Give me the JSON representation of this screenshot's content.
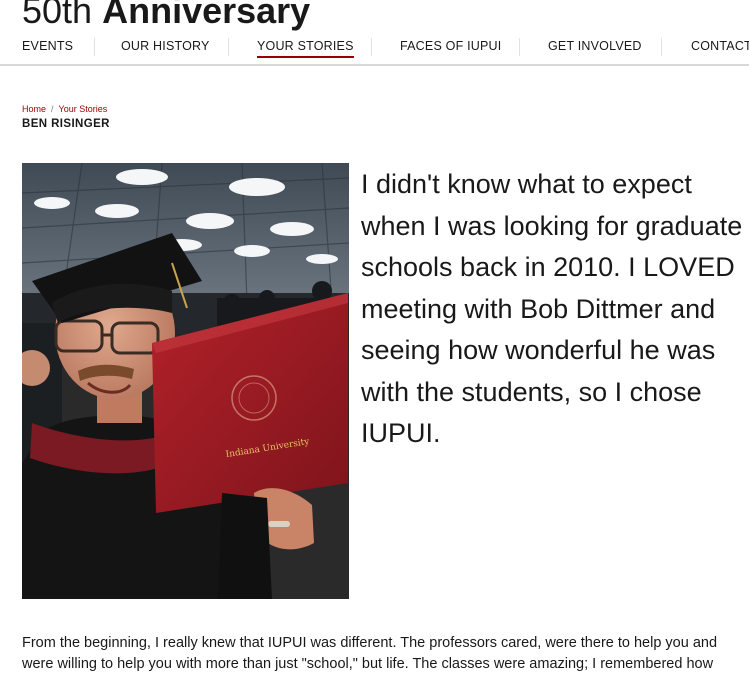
{
  "header": {
    "title_light": "50th",
    "title_bold": "Anniversary"
  },
  "nav": {
    "items": [
      {
        "label": "EVENTS"
      },
      {
        "label": "OUR HISTORY"
      },
      {
        "label": "YOUR STORIES",
        "active": true
      },
      {
        "label": "FACES OF IUPUI"
      },
      {
        "label": "GET INVOLVED"
      },
      {
        "label": "CONTACT"
      }
    ]
  },
  "breadcrumb": {
    "home": "Home",
    "separator": "/",
    "current": "Your Stories"
  },
  "page": {
    "title": "BEN RISINGER"
  },
  "photo": {
    "diploma_text": "Indiana University"
  },
  "quote": "I didn't know what to expect when I was looking for graduate schools back in 2010. I LOVED meeting with Bob Dittmer and seeing how wonderful he was with the students, so I chose IUPUI.",
  "body": {
    "paragraph": "From the beginning, I really knew that IUPUI was different. The professors cared, were there to help you and were willing to help you with more than just \"school,\" but life. The classes were amazing; I remembered how"
  },
  "colors": {
    "accent": "#990000",
    "text": "#191919",
    "rule": "#d8d8d8"
  }
}
